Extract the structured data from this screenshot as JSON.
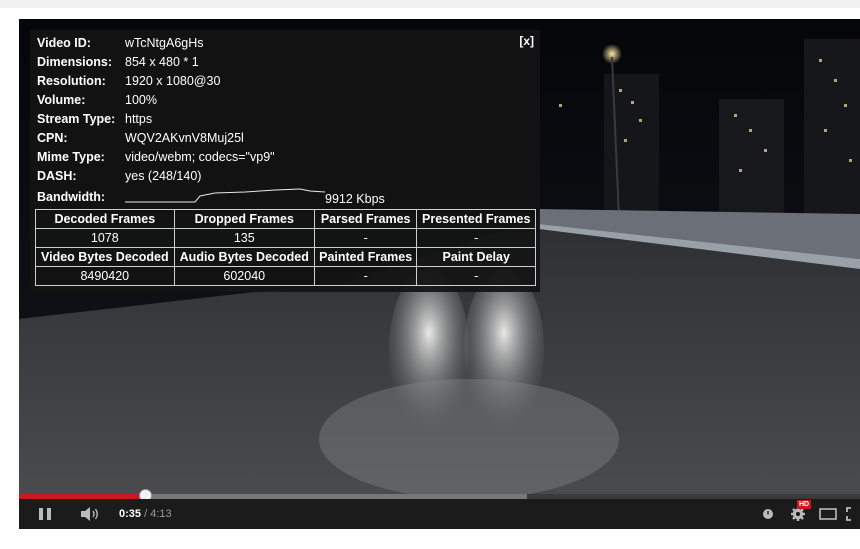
{
  "stats": {
    "close": "[x]",
    "rows": [
      {
        "label": "Video ID:",
        "value": "wTcNtgA6gHs"
      },
      {
        "label": "Dimensions:",
        "value": "854 x 480 * 1"
      },
      {
        "label": "Resolution:",
        "value": "1920 x 1080@30"
      },
      {
        "label": "Volume:",
        "value": "100%"
      },
      {
        "label": "Stream Type:",
        "value": "https"
      },
      {
        "label": "CPN:",
        "value": "WQV2AKvnV8Muj25l"
      },
      {
        "label": "Mime Type:",
        "value": "video/webm; codecs=\"vp9\""
      },
      {
        "label": "DASH:",
        "value": "yes (248/140)"
      }
    ],
    "bandwidth_label": "Bandwidth:",
    "bandwidth_value": "9912 Kbps",
    "table": {
      "h1": [
        "Decoded Frames",
        "Dropped Frames",
        "Parsed Frames",
        "Presented Frames"
      ],
      "v1": [
        "1078",
        "135",
        "-",
        "-"
      ],
      "h2": [
        "Video Bytes Decoded",
        "Audio Bytes Decoded",
        "Painted Frames",
        "Paint Delay"
      ],
      "v2": [
        "8490420",
        "602040",
        "-",
        "-"
      ]
    }
  },
  "controls": {
    "current_time": "0:35",
    "separator": " / ",
    "duration": "4:13",
    "hd_badge": "HD",
    "played_fraction": 0.1502,
    "buffered_fraction": 0.6036
  },
  "colors": {
    "progress_played": "#cc181e",
    "hd_badge": "#cc181e"
  }
}
